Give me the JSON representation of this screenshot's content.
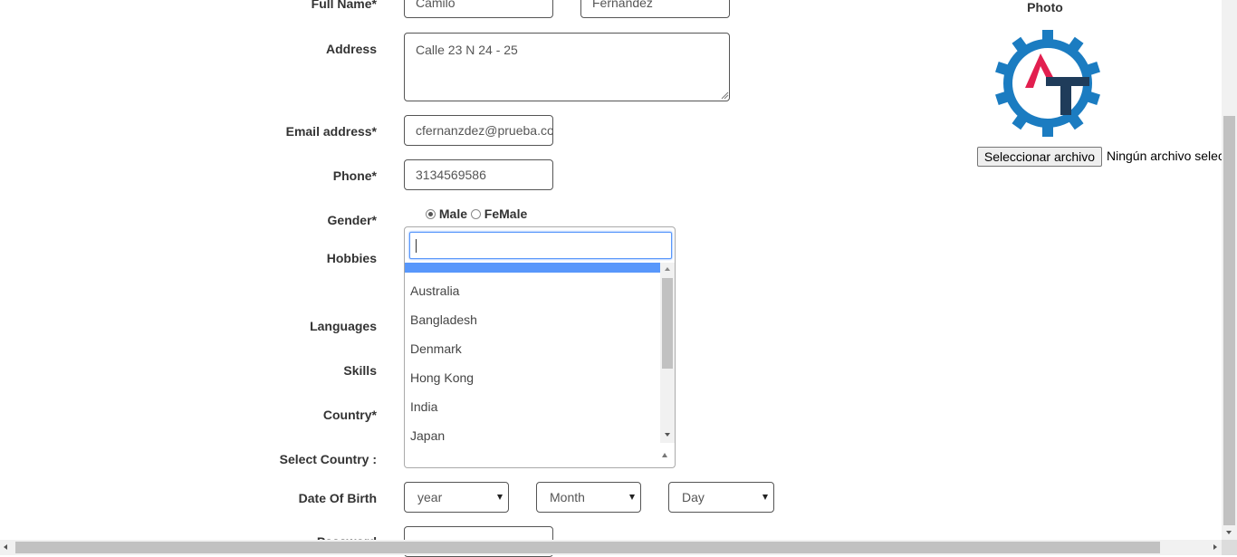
{
  "form": {
    "full_name_label": "Full Name*",
    "first_name_value": "Camilo",
    "last_name_value": "Fernandez",
    "address_label": "Address",
    "address_value": "Calle 23 N 24 - 25",
    "email_label": "Email address*",
    "email_value": "cfernanzdez@prueba.com",
    "phone_label": "Phone*",
    "phone_value": "3134569586",
    "gender_label": "Gender*",
    "gender_options": [
      "Male",
      "FeMale"
    ],
    "gender_selected": "Male",
    "hobbies_label": "Hobbies",
    "languages_label": "Languages",
    "skills_label": "Skills",
    "country_label": "Country*",
    "select_country_label": "Select Country :",
    "dob_label": "Date Of Birth",
    "dob_year": "year",
    "dob_month": "Month",
    "dob_day": "Day",
    "password_label": "Password"
  },
  "country_dropdown": {
    "search_value": "",
    "items": [
      "Australia",
      "Bangladesh",
      "Denmark",
      "Hong Kong",
      "India",
      "Japan"
    ]
  },
  "photo": {
    "label": "Photo",
    "file_button": "Seleccionar archivo",
    "file_status": "Ningún archivo seleccionado"
  },
  "colors": {
    "logo_gear": "#1b7cc1",
    "logo_a": "#e21f4f",
    "logo_t": "#1f3c5a",
    "highlight": "#5897fb"
  }
}
